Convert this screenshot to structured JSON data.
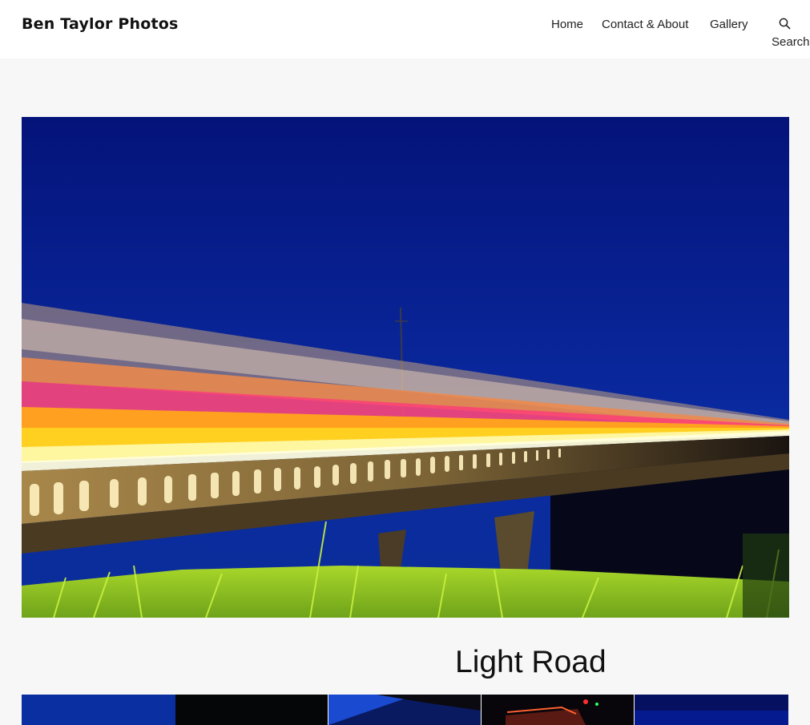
{
  "site": {
    "title": "Ben Taylor Photos"
  },
  "nav": {
    "items": [
      {
        "label": "Home"
      },
      {
        "label": "Contact & About"
      },
      {
        "label": "Gallery"
      }
    ],
    "search_label": "Search"
  },
  "post": {
    "title": "Light Road"
  },
  "colors": {
    "header_bg": "#ffffff",
    "page_bg": "#f7f7f7",
    "text": "#111111",
    "sky": "#06147a"
  },
  "icons": {
    "search": "search-icon"
  }
}
